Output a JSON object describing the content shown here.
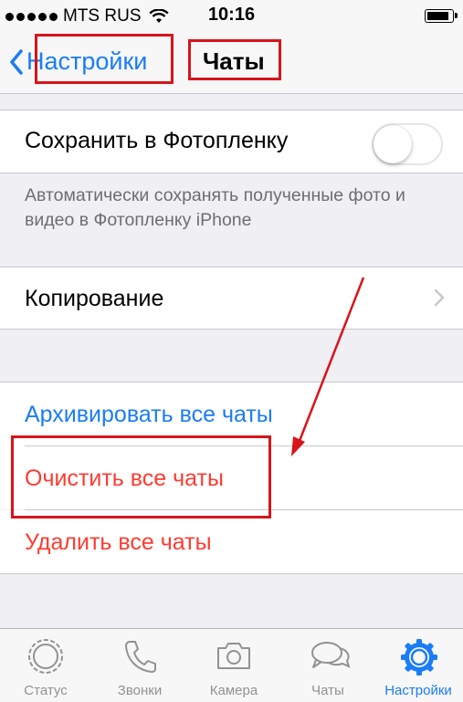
{
  "status_bar": {
    "carrier": "MTS RUS",
    "time": "10:16",
    "battery_level": 0.9
  },
  "nav": {
    "back_label": "Настройки",
    "title": "Чаты"
  },
  "settings": {
    "save_to_camera_roll": {
      "label": "Сохранить в Фотопленку",
      "enabled": false
    },
    "save_footer": "Автоматически сохранять полученные фото и видео в Фотопленку iPhone",
    "backup_label": "Копирование",
    "archive_all_label": "Архивировать все чаты",
    "clear_all_label": "Очистить все чаты",
    "delete_all_label": "Удалить все чаты"
  },
  "tabs": [
    {
      "label": "Статус",
      "icon": "status-icon",
      "active": false
    },
    {
      "label": "Звонки",
      "icon": "phone-icon",
      "active": false
    },
    {
      "label": "Камера",
      "icon": "camera-icon",
      "active": false
    },
    {
      "label": "Чаты",
      "icon": "chats-icon",
      "active": false
    },
    {
      "label": "Настройки",
      "icon": "gear-icon",
      "active": true
    }
  ],
  "colors": {
    "ios_blue": "#1a7cf6",
    "destructive_red": "#ff3b30",
    "annotation_red": "#d8141a"
  }
}
